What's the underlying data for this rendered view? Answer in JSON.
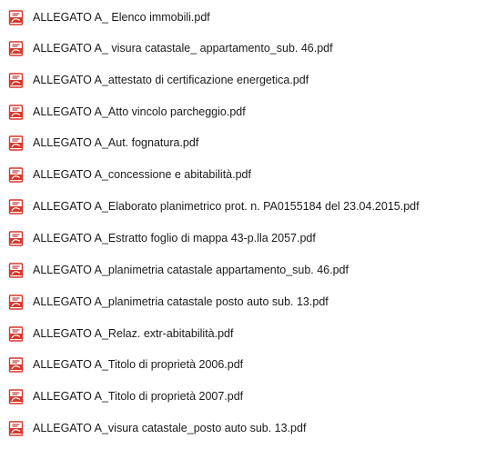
{
  "files": [
    {
      "name": "ALLEGATO A_ Elenco immobili.pdf",
      "icon": "pdf-file-icon"
    },
    {
      "name": "ALLEGATO A_ visura catastale_ appartamento_sub. 46.pdf",
      "icon": "pdf-file-icon"
    },
    {
      "name": "ALLEGATO A_attestato di certificazione energetica.pdf",
      "icon": "pdf-file-icon"
    },
    {
      "name": "ALLEGATO A_Atto vincolo parcheggio.pdf",
      "icon": "pdf-file-icon"
    },
    {
      "name": "ALLEGATO A_Aut. fognatura.pdf",
      "icon": "pdf-file-icon"
    },
    {
      "name": "ALLEGATO A_concessione e abitabilità.pdf",
      "icon": "pdf-file-icon"
    },
    {
      "name": "ALLEGATO A_Elaborato planimetrico prot. n. PA0155184 del 23.04.2015.pdf",
      "icon": "pdf-file-icon"
    },
    {
      "name": "ALLEGATO A_Estratto foglio di mappa 43-p.lla 2057.pdf",
      "icon": "pdf-file-icon"
    },
    {
      "name": "ALLEGATO A_planimetria catastale appartamento_sub. 46.pdf",
      "icon": "pdf-file-icon"
    },
    {
      "name": "ALLEGATO A_planimetria catastale posto auto sub. 13.pdf",
      "icon": "pdf-file-icon"
    },
    {
      "name": "ALLEGATO A_Relaz. extr-abitabilità.pdf",
      "icon": "pdf-file-icon"
    },
    {
      "name": "ALLEGATO A_Titolo di proprietà 2006.pdf",
      "icon": "pdf-file-icon"
    },
    {
      "name": "ALLEGATO A_Titolo di proprietà 2007.pdf",
      "icon": "pdf-file-icon"
    },
    {
      "name": "ALLEGATO A_visura catastale_posto auto sub. 13.pdf",
      "icon": "pdf-file-icon"
    }
  ],
  "colors": {
    "icon_red": "#d9362b",
    "icon_dark_red": "#a8231b",
    "text": "#1a1a1a",
    "background": "#ffffff"
  }
}
